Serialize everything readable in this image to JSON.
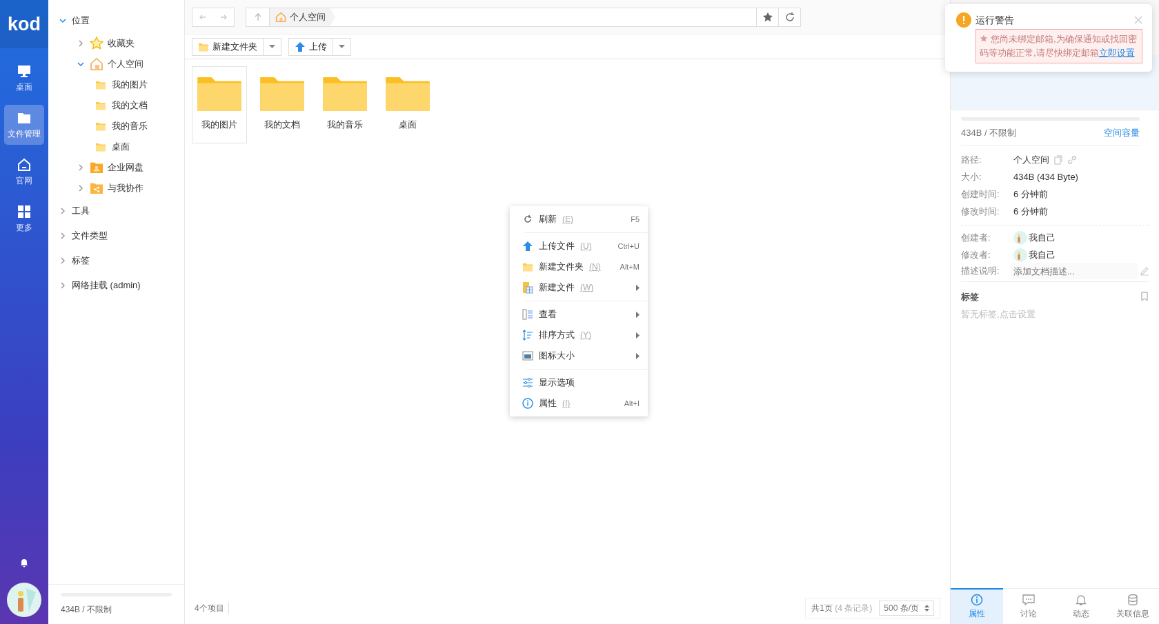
{
  "logo": "kod",
  "nav": [
    {
      "label": "桌面",
      "kind": "monitor",
      "selected": false
    },
    {
      "label": "文件管理",
      "kind": "folder",
      "selected": true
    },
    {
      "label": "官网",
      "kind": "home",
      "selected": false
    },
    {
      "label": "更多",
      "kind": "grid",
      "selected": false
    }
  ],
  "tree": [
    {
      "label": "位置",
      "expanded": true,
      "children": [
        {
          "label": "收藏夹",
          "kind": "star",
          "expanded": false
        },
        {
          "label": "个人空间",
          "kind": "home",
          "expanded": true,
          "children": [
            {
              "label": "我的图片"
            },
            {
              "label": "我的文档"
            },
            {
              "label": "我的音乐"
            },
            {
              "label": "桌面"
            }
          ]
        },
        {
          "label": "企业网盘",
          "kind": "group",
          "expanded": false
        },
        {
          "label": "与我协作",
          "kind": "share",
          "expanded": false
        }
      ]
    },
    {
      "label": "工具",
      "expanded": false
    },
    {
      "label": "文件类型",
      "expanded": false
    },
    {
      "label": "标签",
      "expanded": false
    },
    {
      "label": "网络挂载 (admin)",
      "expanded": false
    }
  ],
  "sidebar_storage": {
    "text": "434B / 不限制",
    "level": 0
  },
  "breadcrumb": "个人空间",
  "toolbar": [
    {
      "label": "新建文件夹",
      "kind": "folder"
    },
    {
      "label": "上传",
      "kind": "upload"
    }
  ],
  "files": [
    {
      "name": "我的图片",
      "selected": true
    },
    {
      "name": "我的文档",
      "selected": false
    },
    {
      "name": "我的音乐",
      "selected": false
    },
    {
      "name": "桌面",
      "selected": false
    }
  ],
  "status": {
    "count": "4个项目",
    "pages": "共1页",
    "records": "(4 条记录)",
    "per_page": "500 条/页"
  },
  "context_menu": [
    [
      {
        "label": "刷新",
        "key": "(E)",
        "shortcut": "F5",
        "kind": "refresh",
        "submenu": false
      }
    ],
    [
      {
        "label": "上传文件",
        "key": "(U)",
        "shortcut": "Ctrl+U",
        "kind": "upload",
        "submenu": false
      },
      {
        "label": "新建文件夹",
        "key": "(N)",
        "shortcut": "Alt+M",
        "kind": "folder",
        "submenu": false
      },
      {
        "label": "新建文件",
        "key": "(W)",
        "kind": "file",
        "submenu": true
      }
    ],
    [
      {
        "label": "查看",
        "kind": "list",
        "submenu": true
      },
      {
        "label": "排序方式",
        "key": "(Y)",
        "kind": "sort",
        "submenu": true
      },
      {
        "label": "图标大小",
        "kind": "image",
        "submenu": true
      }
    ],
    [
      {
        "label": "显示选项",
        "kind": "sliders",
        "submenu": false
      },
      {
        "label": "属性",
        "key": "(I)",
        "shortcut": "Alt+I",
        "kind": "info",
        "submenu": false
      }
    ]
  ],
  "notification": {
    "title": "运行警告",
    "message": "您尚未绑定邮箱,为确保通知或找回密码等功能正常,请尽快绑定邮箱",
    "link": "立即设置"
  },
  "details": {
    "usage": {
      "text": "434B / 不限制",
      "link": "空间容量",
      "level": 0
    },
    "props": [
      {
        "label": "路径:",
        "value": "个人空间",
        "kind": "path"
      },
      {
        "label": "大小:",
        "value": "434B (434 Byte)",
        "kind": "text"
      },
      {
        "label": "创建时间:",
        "value": "6 分钟前",
        "kind": "text"
      },
      {
        "label": "修改时间:",
        "value": "6 分钟前",
        "kind": "text"
      }
    ],
    "people": [
      {
        "label": "创建者:",
        "value": "我自己"
      },
      {
        "label": "修改者:",
        "value": "我自己"
      }
    ],
    "description": {
      "label": "描述说明:",
      "placeholder": "添加文档描述..."
    },
    "tags": {
      "title": "标签",
      "empty": "暂无标签,点击设置"
    },
    "tabs": [
      {
        "label": "属性",
        "kind": "info",
        "selected": true
      },
      {
        "label": "讨论",
        "kind": "chat",
        "selected": false
      },
      {
        "label": "动态",
        "kind": "bell",
        "selected": false
      },
      {
        "label": "关联信息",
        "kind": "db",
        "selected": false
      }
    ]
  }
}
